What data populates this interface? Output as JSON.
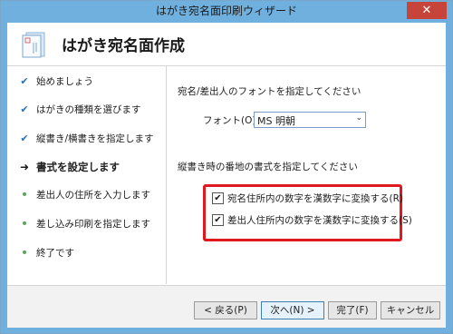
{
  "window": {
    "title": "はがき宛名面印刷ウィザード",
    "close_glyph": "✕"
  },
  "header": {
    "title": "はがき宛名面作成",
    "icon": "postcard-wizard-icon"
  },
  "steps": [
    {
      "label": "始めましょう",
      "mark": "✔",
      "state": "done"
    },
    {
      "label": "はがきの種類を選びます",
      "mark": "✔",
      "state": "done"
    },
    {
      "label": "縦書き/横書きを指定します",
      "mark": "✔",
      "state": "done"
    },
    {
      "label": "書式を設定します",
      "mark": "➜",
      "state": "current"
    },
    {
      "label": "差出人の住所を入力します",
      "mark": "•",
      "state": "future"
    },
    {
      "label": "差し込み印刷を指定します",
      "mark": "•",
      "state": "future"
    },
    {
      "label": "終了です",
      "mark": "•",
      "state": "future"
    }
  ],
  "main": {
    "font_section_label": "宛名/差出人のフォントを指定してください",
    "font_label": "フォント(O):",
    "font_value": "MS 明朝",
    "dropdown_arrow": "⌄",
    "number_section_label": "縦書き時の番地の書式を指定してください",
    "checkboxes": [
      {
        "label": "宛名住所内の数字を漢数字に変換する(R)",
        "checked": true,
        "glyph": "✔"
      },
      {
        "label": "差出人住所内の数字を漢数字に変換する(S)",
        "checked": true,
        "glyph": "✔"
      }
    ]
  },
  "footer": {
    "back": "< 戻る(P)",
    "next": "次へ(N) >",
    "finish": "完了(F)",
    "cancel": "キャンセル"
  },
  "colors": {
    "titlebar": "#6fb0df",
    "highlight": "#e0191e",
    "close": "#c7443a"
  }
}
